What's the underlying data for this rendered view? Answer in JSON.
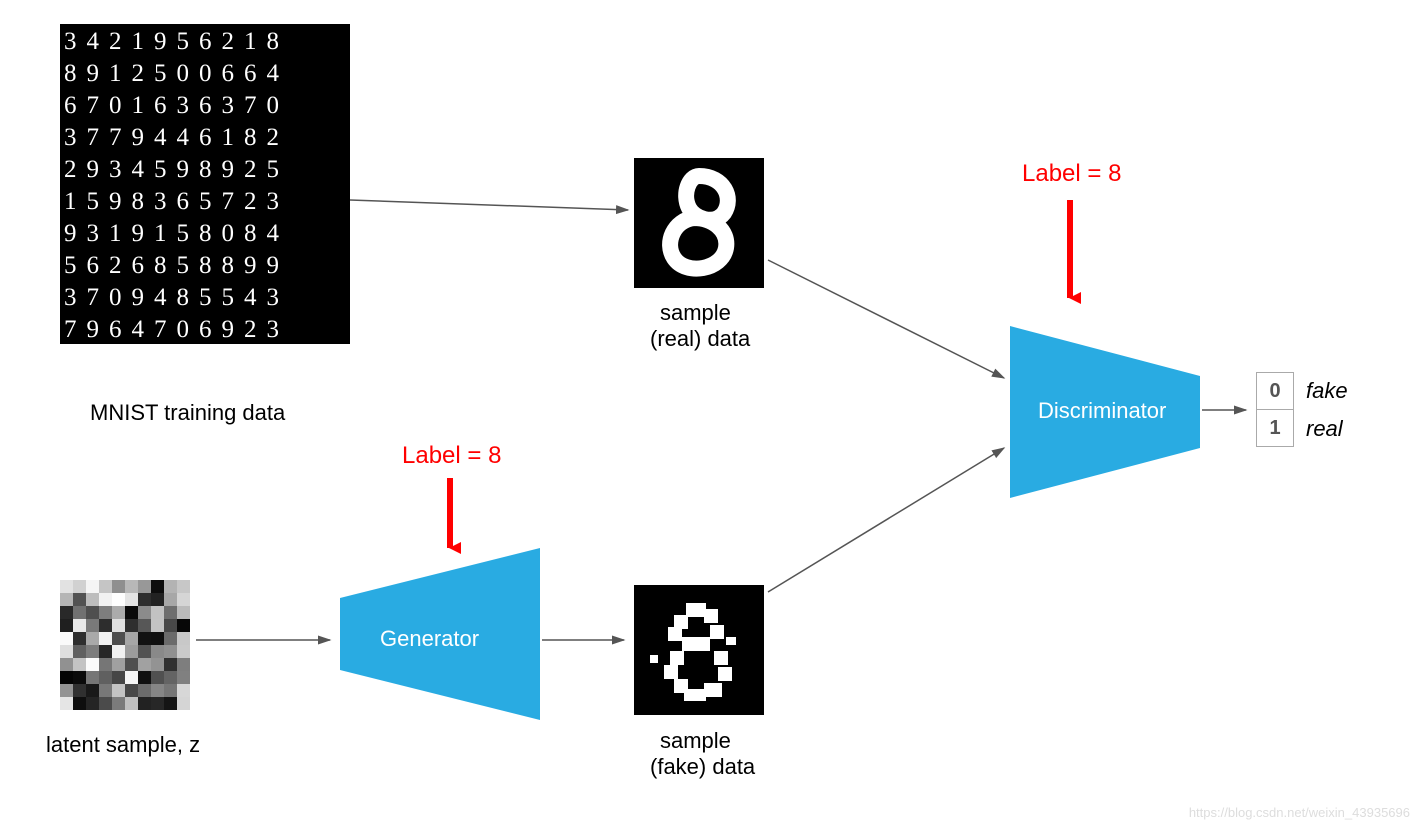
{
  "mnist_caption": "MNIST training data",
  "latent_caption": "latent sample, z",
  "sample_real_line1": "sample",
  "sample_real_line2": "(real) data",
  "sample_fake_line1": "sample",
  "sample_fake_line2": "(fake) data",
  "generator_label": "Generator",
  "discriminator_label": "Discriminator",
  "label_gen": "Label = 8",
  "label_disc": "Label = 8",
  "out0": "0",
  "out1": "1",
  "out0_text": "fake",
  "out1_text": "real",
  "watermark": "https://blog.csdn.net/weixin_43935696",
  "mnist_rows": [
    "3421956218",
    "8912500664",
    "6701636370",
    "3779446182",
    "2934598925",
    "1598365723",
    "9319158084",
    "5626858899",
    "3709485543",
    "7964706923"
  ]
}
